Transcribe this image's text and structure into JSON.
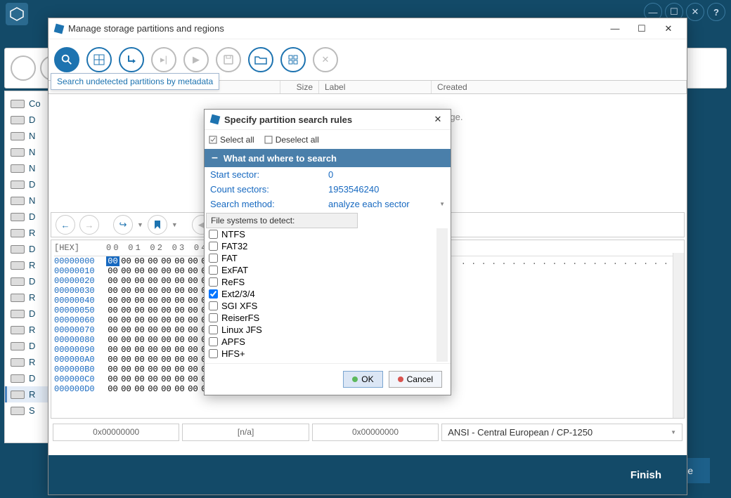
{
  "bg": {
    "sidebar_items": [
      "Co",
      "D",
      "N",
      "N",
      "N",
      "D",
      "N",
      "D",
      "R",
      "D",
      "R",
      "D",
      "R",
      "D",
      "R",
      "D",
      "R",
      "D",
      "R",
      "S"
    ]
  },
  "main_window": {
    "title": "Manage storage partitions and regions",
    "tooltip": "Search undetected partitions by metadata",
    "columns": {
      "size": "Size",
      "label": "Label",
      "created": "Created"
    },
    "no_partitions": "No partitions or regions defined on the storage.",
    "footer_btn": "Finish"
  },
  "hex": {
    "header_tag": "[HEX]",
    "header_bytes": "00 01 02 03 04 05 06 07",
    "lines": [
      {
        "addr": "00000000",
        "first_sel": true
      },
      {
        "addr": "00000010"
      },
      {
        "addr": "00000020"
      },
      {
        "addr": "00000030"
      },
      {
        "addr": "00000040"
      },
      {
        "addr": "00000050"
      },
      {
        "addr": "00000060"
      },
      {
        "addr": "00000070"
      },
      {
        "addr": "00000080"
      },
      {
        "addr": "00000090"
      },
      {
        "addr": "000000A0"
      },
      {
        "addr": "000000B0"
      },
      {
        "addr": "000000C0"
      },
      {
        "addr": "000000D0"
      }
    ],
    "ascii_line": ". . . . . . . . . . . . . . . . . . . . ."
  },
  "status": {
    "offset1": "0x00000000",
    "na": "[n/a]",
    "offset2": "0x00000000",
    "encoding": "ANSI - Central European / CP-1250"
  },
  "dialog": {
    "title": "Specify partition search rules",
    "select_all": "Select all",
    "deselect_all": "Deselect all",
    "section_title": "What and where to search",
    "meta": {
      "start_sector_lbl": "Start sector:",
      "start_sector_val": "0",
      "count_sectors_lbl": "Count sectors:",
      "count_sectors_val": "1953546240",
      "method_lbl": "Search method:",
      "method_val": "analyze each sector"
    },
    "fs_header": "File systems to detect:",
    "fs_items": [
      {
        "name": "NTFS",
        "checked": false
      },
      {
        "name": "FAT32",
        "checked": false
      },
      {
        "name": "FAT",
        "checked": false
      },
      {
        "name": "ExFAT",
        "checked": false
      },
      {
        "name": "ReFS",
        "checked": false
      },
      {
        "name": "Ext2/3/4",
        "checked": true
      },
      {
        "name": "SGI XFS",
        "checked": false
      },
      {
        "name": "ReiserFS",
        "checked": false
      },
      {
        "name": "Linux JFS",
        "checked": false
      },
      {
        "name": "APFS",
        "checked": false
      },
      {
        "name": "HFS+",
        "checked": false
      }
    ],
    "ok": "OK",
    "cancel": "Cancel"
  },
  "bg_right_btn": "re"
}
